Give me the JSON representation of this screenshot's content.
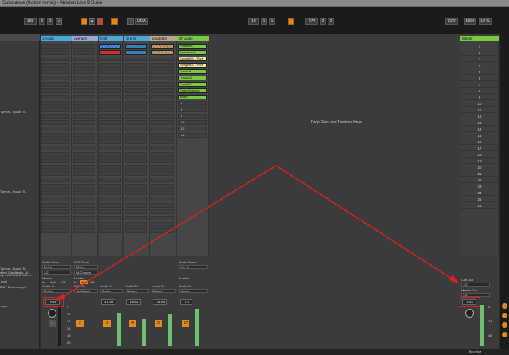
{
  "window": {
    "title": "Substance (Kokim remix) - Ableton Live 9 Suite"
  },
  "toolbar": {
    "tempo": "105",
    "signature": "2",
    "quantize": "1 Bar",
    "new_label": "NEW",
    "position": "10",
    "position_b": "1",
    "position_c": "1",
    "loop_end": "274",
    "loop_end_b": "2",
    "loop_end_c": "2",
    "key_label": "KEY",
    "midi_label": "MIDI",
    "cpu": "19 %"
  },
  "browser": {
    "items": [
      "Tymon - Space Ti...",
      "Tymon - Space Ti...",
      "xly - MGTVLN/FAG.m...",
      "dited Crispitastic 16...",
      "Tymon - Space Ti...",
      "xly - MGTVLN/FAG.m...",
      ".mp3",
      "DMT Dreams.mp3",
      ".mp3"
    ]
  },
  "tracks": [
    {
      "name": "1 Audio",
      "color": "#4da8e0"
    },
    {
      "name": "overachi",
      "color": "#9aa8d6"
    },
    {
      "name": "KnB",
      "color": "#4da8e0"
    },
    {
      "name": "Drums",
      "color": "#4da8e0"
    },
    {
      "name": "Leads&In",
      "color": "#b8a88a"
    },
    {
      "name": "27 Audio",
      "color": "#7ac943"
    },
    {
      "name": "Master",
      "color": "#7ac943"
    }
  ],
  "clips": [
    "Vocalpha",
    "Instru back",
    "Songbit01 - Part",
    "Songbit01 - Part",
    "Tracks9",
    "Tracks11",
    "Track59",
    "Voice Spectre",
    "tower"
  ],
  "clip_colors": {
    "green": "#7ac943",
    "cream": "#f2e6a0",
    "blue_hatch": "#4a8ee8",
    "red_hatch": "#d03030",
    "tan_hatch": "#c8a070"
  },
  "scene_numbers": [
    "1",
    "2",
    "3",
    "4",
    "5",
    "6",
    "7",
    "8",
    "9",
    "10",
    "11",
    "12",
    "13",
    "14",
    "15",
    "16",
    "17",
    "18",
    "19",
    "20",
    "21",
    "22",
    "23",
    "24",
    "25",
    "26"
  ],
  "lower_slot_labels": [
    "1",
    "4",
    "8",
    "16",
    "32",
    "64"
  ],
  "drop_hint": "Drop Files and Devices Here",
  "io": {
    "audio_from": "Audio From",
    "ext_in": "Ext. In",
    "midi_from": "MIDI From",
    "all_ins": "All Ins",
    "all_channels": "All Channe",
    "monitor": "Monitor",
    "in": "In",
    "auto": "Auto",
    "off": "Off",
    "audio_to": "Audio To",
    "midi_to": "MIDI To",
    "master": "Master",
    "no_output": "No Output",
    "cue_out": "Cue Out",
    "cue_value": "1/2",
    "master_out": "Master Out",
    "master_out_value": "1/2"
  },
  "mixer": {
    "volumes": [
      "-7.20",
      "-10.90",
      "-10.52",
      "-18.00",
      "-9.0"
    ],
    "master_volume": "-7.21",
    "track_numbers": [
      "1",
      "2",
      "3",
      "4",
      "5",
      "27"
    ],
    "scale_labels": [
      "0",
      "12",
      "24",
      "36",
      "48",
      "60"
    ]
  },
  "status": {
    "master_label": "Master"
  }
}
